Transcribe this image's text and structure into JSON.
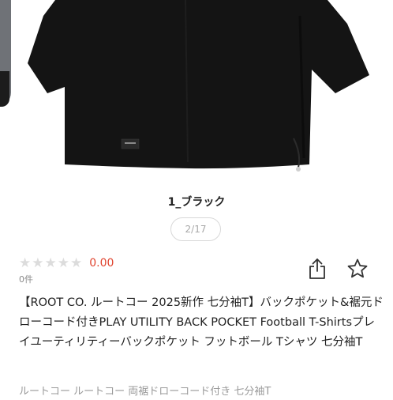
{
  "product": {
    "variant_label": "1_ブラック",
    "pager": "2/17",
    "rating": {
      "stars_filled": 0,
      "stars_total": 5,
      "score": "0.00",
      "count": "0件"
    },
    "title": "【ROOT CO. ルートコー 2025新作 七分袖T】バックポケット&裾元ドローコード付きPLAY UTILITY BACK POCKET Football T-Shirtsプレイユーティリティーバックポケット フットボール Tシャツ 七分袖T",
    "desc_preview": "ルートコー ルートコー 両裾ドローコード付き 七分袖T"
  },
  "icons": {
    "share": "share-icon",
    "favorite": "star-outline-icon",
    "rating_star": "star-icon"
  },
  "colors": {
    "score": "#e0442f",
    "star_empty": "#dcdcdc",
    "shirt": "#141414"
  }
}
